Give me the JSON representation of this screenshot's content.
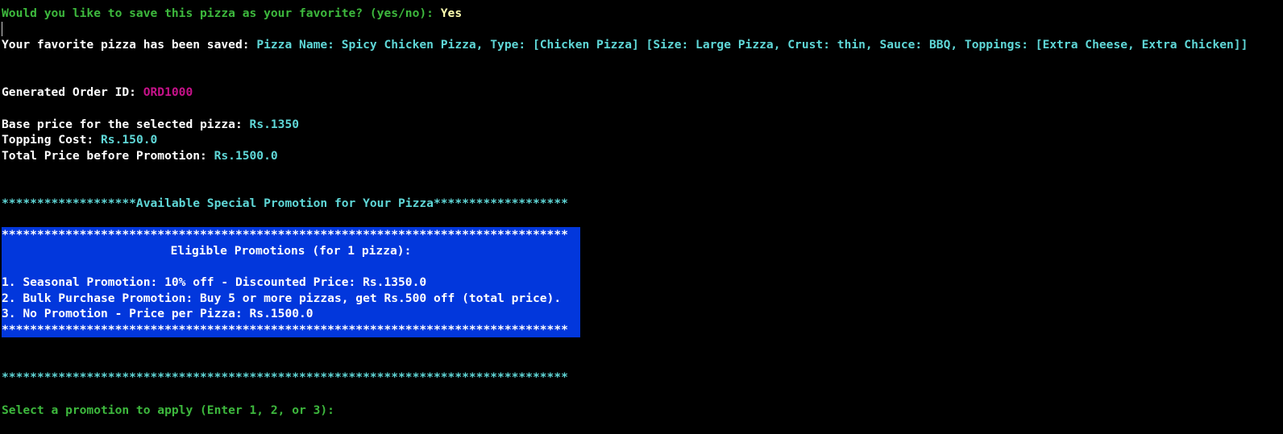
{
  "terminal": {
    "save_prompt": "Would you like to save this pizza as your favorite? (yes/no): ",
    "save_answer": "Yes",
    "saved_label": "Your favorite pizza has been saved: ",
    "saved_detail": "Pizza Name: Spicy Chicken Pizza, Type: [Chicken Pizza] [Size: Large Pizza, Crust: thin, Sauce: BBQ, Toppings: [Extra Cheese, Extra Chicken]]",
    "order_id_label": "Generated Order ID: ",
    "order_id": "ORD1000",
    "base_price_label": "Base price for the selected pizza: ",
    "base_price": "Rs.1350",
    "topping_cost_label": "Topping Cost: ",
    "topping_cost": "Rs.150.0",
    "total_price_label": "Total Price before Promotion: ",
    "total_price": "Rs.1500.0",
    "promo_header": "*******************Available Special Promotion for Your Pizza*******************",
    "promo_box": {
      "border_top": "********************************************************************************",
      "title": "Eligible Promotions (for 1 pizza):",
      "options": [
        "1. Seasonal Promotion: 10% off - Discounted Price: Rs.1350.0",
        "2. Bulk Purchase Promotion: Buy 5 or more pizzas, get Rs.500 off (total price).",
        "3. No Promotion - Price per Pizza: Rs.1500.0"
      ],
      "border_bottom": "********************************************************************************",
      "background_color": "#0237dc"
    },
    "separator": "********************************************************************************",
    "select_prompt": "Select a promotion to apply (Enter 1, 2, or 3): "
  },
  "colors": {
    "background": "#000000",
    "prompt_green": "#3db83d",
    "value_cyan": "#5fd7d7",
    "order_id_magenta": "#c7128a",
    "answer_yellow": "#ffffb0",
    "text_white": "#ffffff"
  }
}
